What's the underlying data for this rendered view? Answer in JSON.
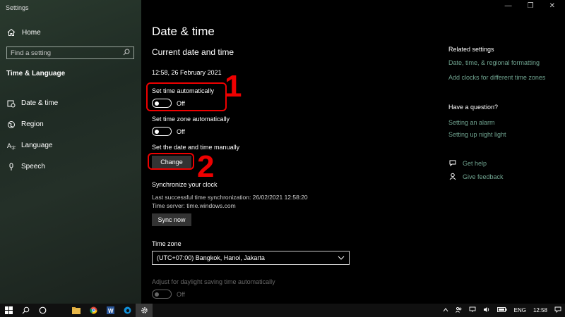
{
  "window": {
    "title": "Settings"
  },
  "sidebar": {
    "home_label": "Home",
    "search_placeholder": "Find a setting",
    "section_label": "Time & Language",
    "items": [
      {
        "label": "Date & time",
        "icon": "calendar-clock-icon"
      },
      {
        "label": "Region",
        "icon": "globe-icon"
      },
      {
        "label": "Language",
        "icon": "language-icon"
      },
      {
        "label": "Speech",
        "icon": "microphone-icon"
      }
    ]
  },
  "main": {
    "title": "Date & time",
    "subtitle": "Current date and time",
    "current_datetime": "12:58, 26 February 2021",
    "set_time_auto": {
      "label": "Set time automatically",
      "state": "Off"
    },
    "set_tz_auto": {
      "label": "Set time zone automatically",
      "state": "Off"
    },
    "manual": {
      "label": "Set the date and time manually",
      "button": "Change"
    },
    "sync": {
      "heading": "Synchronize your clock",
      "last_sync": "Last successful time synchronization: 26/02/2021 12:58:20",
      "server": "Time server: time.windows.com",
      "button": "Sync now"
    },
    "timezone": {
      "label": "Time zone",
      "value": "(UTC+07:00) Bangkok, Hanoi, Jakarta"
    },
    "dst": {
      "label": "Adjust for daylight saving time automatically",
      "state": "Off"
    }
  },
  "annotations": {
    "one": "1",
    "two": "2"
  },
  "right": {
    "related_heading": "Related settings",
    "related_links": [
      "Date, time, & regional formatting",
      "Add clocks for different time zones"
    ],
    "question_heading": "Have a question?",
    "question_links": [
      "Setting an alarm",
      "Setting up night light"
    ],
    "help": "Get help",
    "feedback": "Give feedback"
  },
  "taskbar": {
    "language": "ENG",
    "time": "12:58"
  },
  "colors": {
    "accent_link": "#6fa38f",
    "annotation": "#e00000"
  }
}
